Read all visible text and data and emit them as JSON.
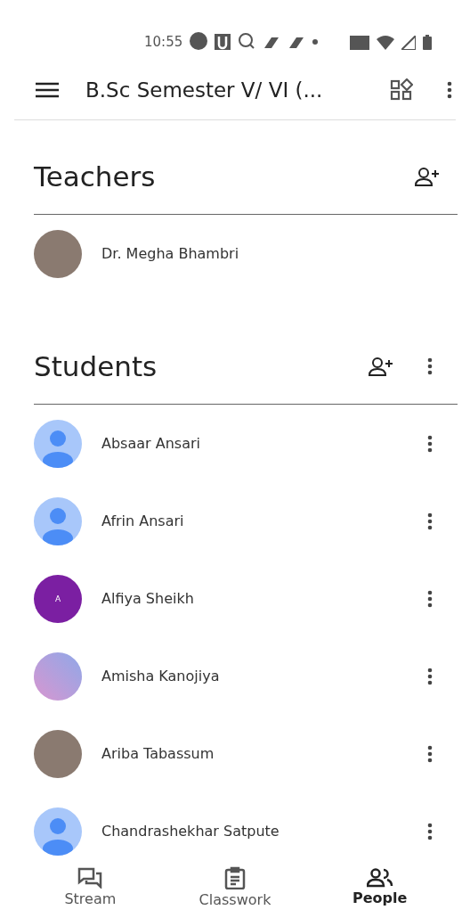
{
  "status_bar": {
    "time": "10:55"
  },
  "app_bar": {
    "title": "B.Sc Semester V/ VI (..."
  },
  "sections": [
    {
      "title": "Teachers",
      "kind": "teachers",
      "people": [
        {
          "name": "Dr. Megha Bhambri",
          "avatar": {
            "kind": "photo"
          }
        }
      ]
    },
    {
      "title": "Students",
      "kind": "students",
      "people": [
        {
          "name": "Absaar Ansari",
          "avatar": {
            "kind": "default"
          }
        },
        {
          "name": "Afrin Ansari",
          "avatar": {
            "kind": "default"
          }
        },
        {
          "name": "Alfiya Sheikh",
          "avatar": {
            "kind": "letter",
            "letter": "A",
            "color": "#7b1fa2"
          }
        },
        {
          "name": "Amisha Kanojiya",
          "avatar": {
            "kind": "gradient"
          }
        },
        {
          "name": "Ariba Tabassum",
          "avatar": {
            "kind": "photo"
          }
        },
        {
          "name": "Chandrashekhar Satpute",
          "avatar": {
            "kind": "default"
          }
        }
      ]
    }
  ],
  "bottom_nav": [
    {
      "label": "Stream",
      "selected": false
    },
    {
      "label": "Classwork",
      "selected": false
    },
    {
      "label": "People",
      "selected": true
    }
  ]
}
